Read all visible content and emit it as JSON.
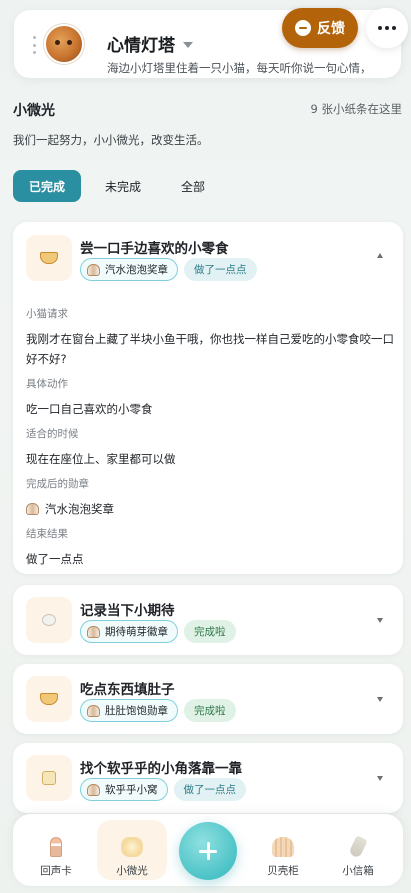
{
  "header": {
    "title": "心情灯塔",
    "subtitle": "海边小灯塔里住着一只小猫，每天听你说一句心情，",
    "feedback_label": "反馈"
  },
  "section": {
    "title": "小微光",
    "count_text": "9 张小纸条在这里",
    "description": "我们一起努力，小小微光，改变生活。"
  },
  "tabs": [
    {
      "label": "已完成",
      "active": true
    },
    {
      "label": "未完成",
      "active": false
    },
    {
      "label": "全部",
      "active": false
    }
  ],
  "cards": [
    {
      "title": "尝一口手边喜欢的小零食",
      "badge": "汽水泡泡奖章",
      "status": "做了一点点",
      "expanded": true,
      "details": {
        "request_label": "小猫请求",
        "request_value": "我刚才在窗台上藏了半块小鱼干哦，你也找一样自己爱吃的小零食咬一口好不好?",
        "action_label": "具体动作",
        "action_value": "吃一口自己喜欢的小零食",
        "timing_label": "适合的时候",
        "timing_value": "现在在座位上、家里都可以做",
        "badge_label": "完成后的勋章",
        "badge_value": "汽水泡泡奖章",
        "result_label": "结束结果",
        "result_value": "做了一点点"
      }
    },
    {
      "title": "记录当下小期待",
      "badge": "期待萌芽徽章",
      "status": "完成啦",
      "expanded": false
    },
    {
      "title": "吃点东西填肚子",
      "badge": "肚肚饱饱勋章",
      "status": "完成啦",
      "expanded": false
    },
    {
      "title": "找个软乎乎的小角落靠一靠",
      "badge": "软乎乎小窝",
      "status": "做了一点点",
      "expanded": false
    }
  ],
  "nav": {
    "items": [
      {
        "label": "回声卡",
        "icon": "lighthouse-icon"
      },
      {
        "label": "小微光",
        "icon": "light-icon",
        "active": true
      },
      {
        "label": "贝壳柜",
        "icon": "shell-icon"
      },
      {
        "label": "小信箱",
        "icon": "bottle-icon"
      }
    ]
  },
  "colors": {
    "accent_teal": "#2a8fa0",
    "feedback_brown": "#b3630a",
    "chip_border": "#7fd0dc"
  }
}
